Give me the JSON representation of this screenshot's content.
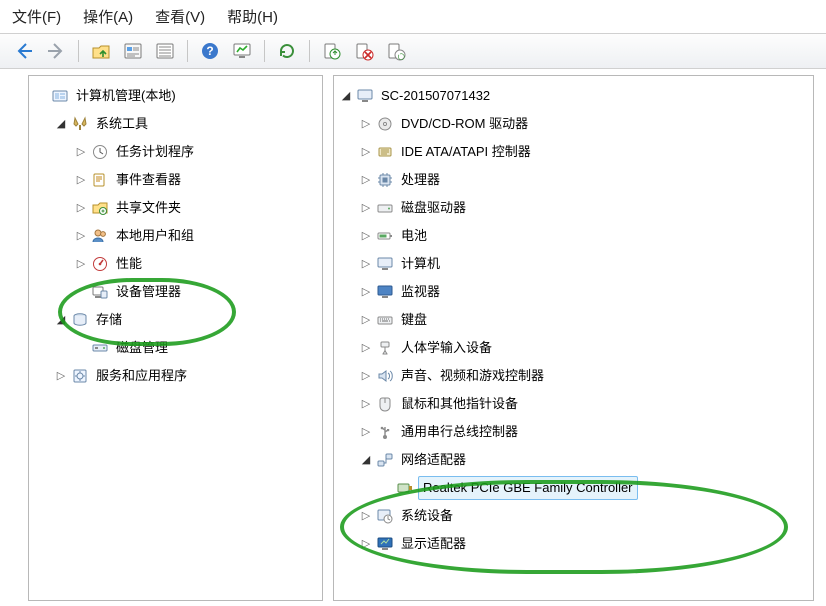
{
  "menu": {
    "file": "文件(F)",
    "action": "操作(A)",
    "view": "查看(V)",
    "help": "帮助(H)"
  },
  "left": {
    "root": "计算机管理(本地)",
    "sysTools": "系统工具",
    "taskScheduler": "任务计划程序",
    "eventViewer": "事件查看器",
    "sharedFolders": "共享文件夹",
    "localUsersGroups": "本地用户和组",
    "performance": "性能",
    "deviceManager": "设备管理器",
    "storage": "存储",
    "diskMgmt": "磁盘管理",
    "services": "服务和应用程序"
  },
  "right": {
    "root": "SC-201507071432",
    "dvd": "DVD/CD-ROM 驱动器",
    "ide": "IDE ATA/ATAPI 控制器",
    "cpu": "处理器",
    "diskDrive": "磁盘驱动器",
    "battery": "电池",
    "computer": "计算机",
    "monitor": "监视器",
    "keyboard": "键盘",
    "hid": "人体学输入设备",
    "sound": "声音、视频和游戏控制器",
    "mouse": "鼠标和其他指针设备",
    "usb": "通用串行总线控制器",
    "netAdapter": "网络适配器",
    "realtek": "Realtek PCIe GBE Family Controller",
    "sysDevices": "系统设备",
    "display": "显示适配器"
  }
}
